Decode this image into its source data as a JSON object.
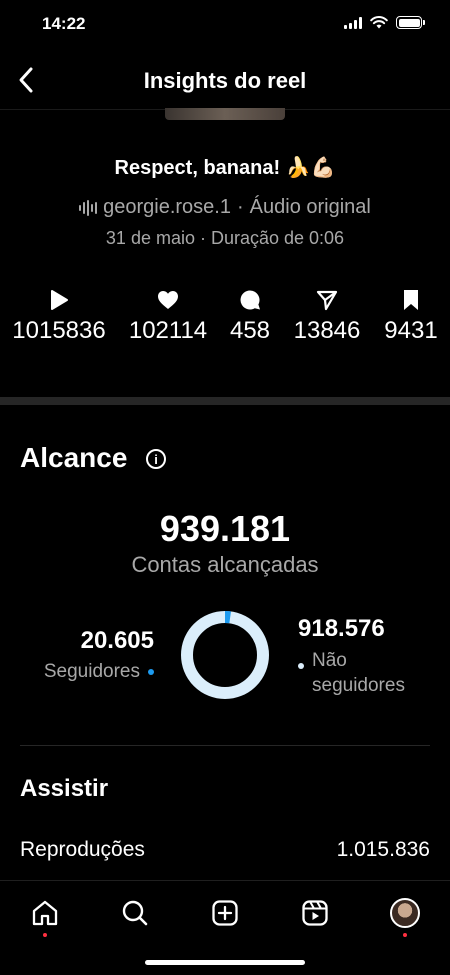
{
  "status_bar": {
    "time": "14:22"
  },
  "header": {
    "title": "Insights do reel"
  },
  "reel": {
    "title": "Respect, banana! 🍌💪🏻",
    "author": "georgie.rose.1",
    "separator": "·",
    "audio_label": "Áudio original",
    "date_line": "31 de maio · Duração de 0:06"
  },
  "stats": [
    {
      "icon": "play-icon",
      "value": "1015836"
    },
    {
      "icon": "heart-icon",
      "value": "102114"
    },
    {
      "icon": "comment-icon",
      "value": "458"
    },
    {
      "icon": "share-icon",
      "value": "13846"
    },
    {
      "icon": "bookmark-icon",
      "value": "9431"
    }
  ],
  "reach": {
    "title": "Alcance",
    "info_glyph": "i",
    "accounts_reached": "939.181",
    "accounts_reached_label": "Contas alcançadas",
    "followers_value": "20.605",
    "followers_label": "Seguidores",
    "non_followers_value": "918.576",
    "non_followers_label_line1": "Não",
    "non_followers_label_line2": "seguidores",
    "followers_fraction": 0.0219,
    "colors": {
      "followers": "#1d9bf0",
      "non_followers": "#dbeefb"
    }
  },
  "watch": {
    "title": "Assistir",
    "plays_label": "Reproduções",
    "plays_value": "1.015.836"
  },
  "tabbar": {
    "items": [
      {
        "icon": "home-icon",
        "has_dot": true
      },
      {
        "icon": "search-icon",
        "has_dot": false
      },
      {
        "icon": "create-icon",
        "has_dot": false
      },
      {
        "icon": "reels-icon",
        "has_dot": false
      },
      {
        "icon": "profile-avatar",
        "has_dot": true
      }
    ]
  }
}
